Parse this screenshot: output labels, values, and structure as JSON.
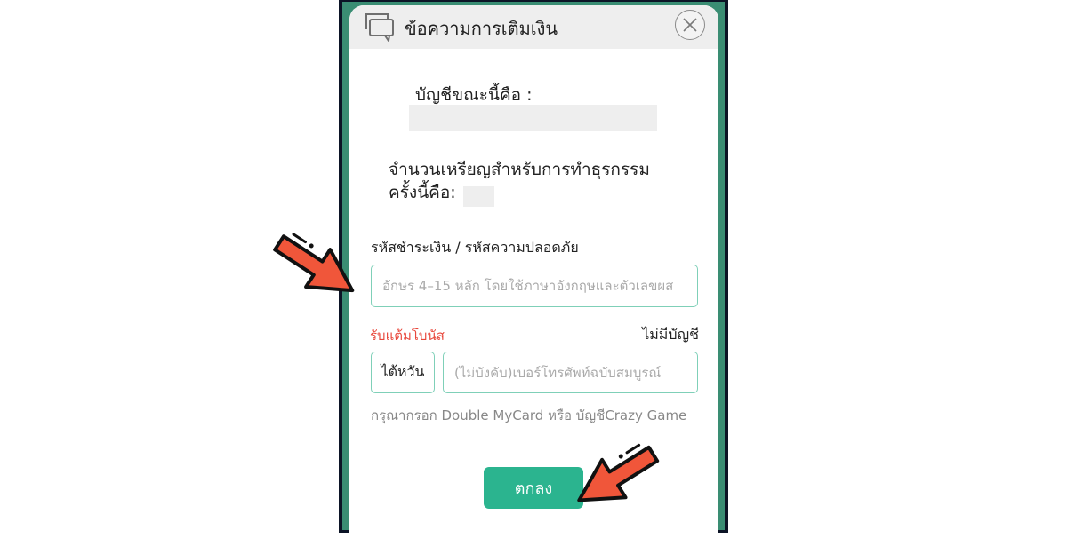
{
  "dialog": {
    "title": "ข้อความการเติมเงิน",
    "account_label": "บัญชีขณะนี้คือ :",
    "coins_label_line1": "จำนวนเหรียญสำหรับการทำธุรกรรม",
    "coins_label_line2": "ครั้งนี้คือ:",
    "code_label": "รหัสชำระเงิน / รหัสความปลอดภัย",
    "code_placeholder": "อักษร 4–15 หลัก โดยใช้ภาษาอังกฤษและตัวเลขผส",
    "bonus_label": "รับแต้มโบนัส",
    "no_account_link": "ไม่มีบัญชี",
    "region_button": "ไต้หวัน",
    "phone_placeholder": "(ไม่บังคับ)เบอร์โทรศัพท์ฉบับสมบูรณ์",
    "hint": "กรุณากรอก Double MyCard หรือ บัญชีCrazy Game",
    "ok_button": "ตกลง"
  },
  "colors": {
    "accent": "#2bb48f",
    "bonus_text": "#e8473b",
    "input_border": "#7fd0b8",
    "annotation_arrow": "#f0563a"
  },
  "icons": {
    "header": "chat-bubbles-icon",
    "close": "close-icon",
    "annotation": "pointer-arrow-icon"
  }
}
